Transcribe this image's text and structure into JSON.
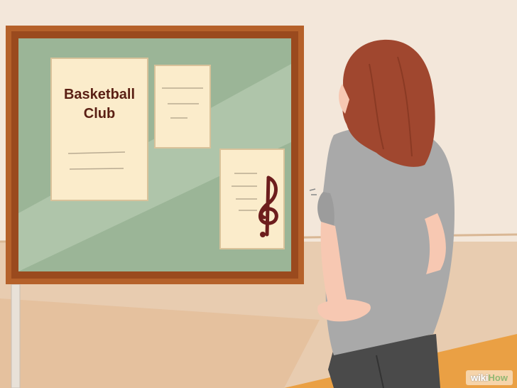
{
  "poster_main": {
    "line1": "Basketball",
    "line2": "Club"
  },
  "watermark": {
    "part1": "wiki",
    "part2": "How"
  },
  "colors": {
    "board_green": "#9bb597",
    "frame_brown": "#b5612a",
    "paper": "#fbeccb",
    "wall": "#f3e7da",
    "floor": "#eaa044",
    "shirt": "#a9a9a9",
    "hair": "#a0472f",
    "skin": "#f7c8b2",
    "jeans": "#4a4a4a",
    "treble_clef": "#6d1d1d"
  },
  "icons": [
    "treble-clef-icon",
    "wikihow-logo"
  ]
}
